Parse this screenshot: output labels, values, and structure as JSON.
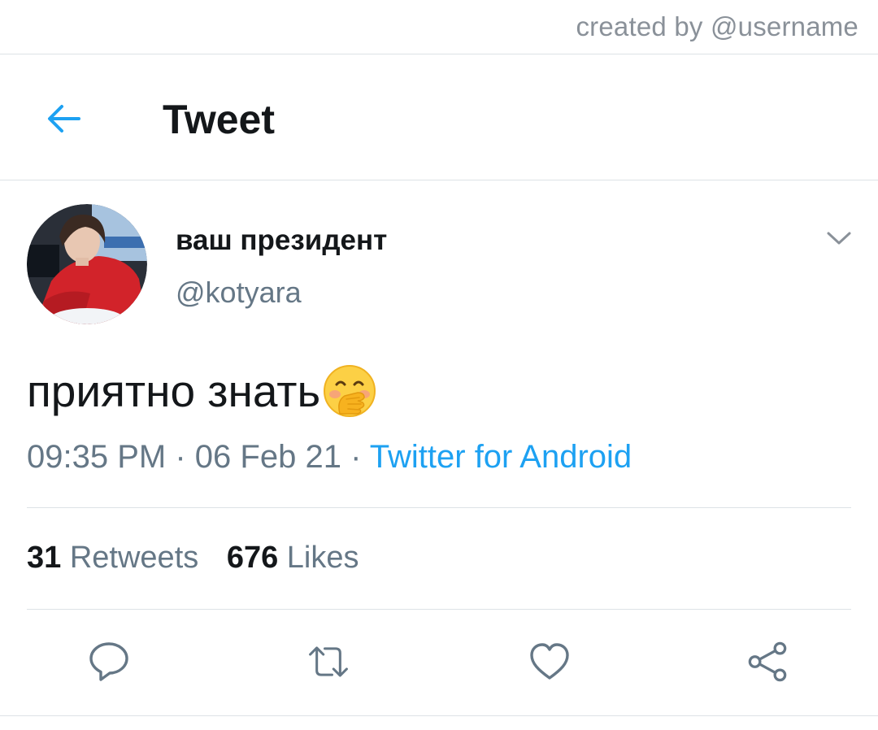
{
  "watermark": "created by @username",
  "header": {
    "title": "Tweet",
    "back_icon": "arrow-left-icon",
    "accent_color": "#1da1f2"
  },
  "tweet": {
    "display_name": "ваш президент",
    "handle": "@kotyara",
    "text": "приятно знать",
    "emoji": "face-with-hand-over-mouth-icon",
    "time": "09:35 PM",
    "date": "06 Feb 21",
    "separator": "·",
    "source": "Twitter for Android"
  },
  "stats": {
    "retweets_count": "31",
    "retweets_label": "Retweets",
    "likes_count": "676",
    "likes_label": "Likes"
  },
  "actions": [
    {
      "icon": "reply-icon"
    },
    {
      "icon": "retweet-icon"
    },
    {
      "icon": "like-icon"
    },
    {
      "icon": "share-icon"
    }
  ],
  "colors": {
    "text": "#14171a",
    "secondary": "#657786",
    "link": "#1da1f2",
    "divider": "#dde2e6"
  }
}
